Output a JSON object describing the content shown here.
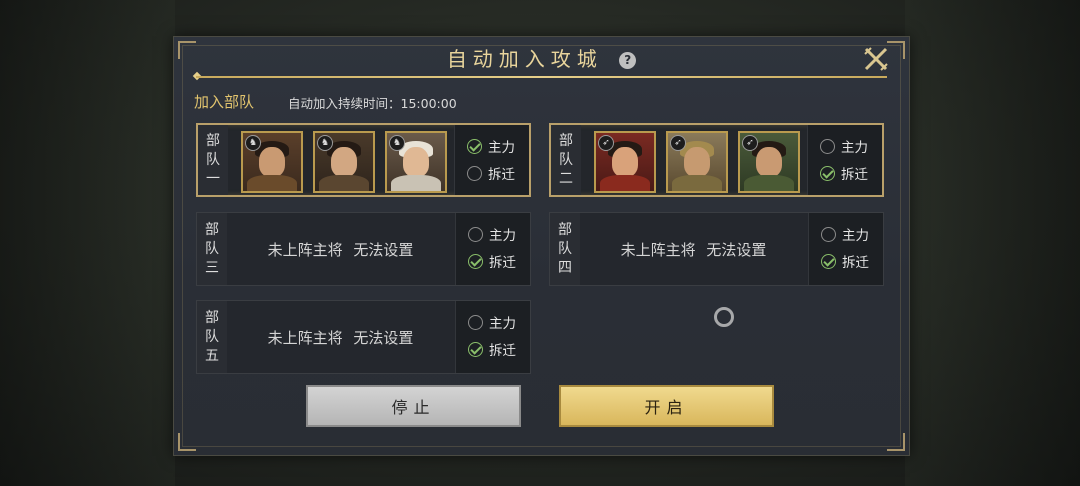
{
  "dialog": {
    "title": "自动加入攻城",
    "help": "?",
    "section_label": "加入部队",
    "duration": "自动加入持续时间：15:00:00"
  },
  "troops": [
    {
      "label": [
        "部",
        "队",
        "一"
      ],
      "portraits": [
        "horse",
        "horse",
        "horse"
      ],
      "options": [
        "主力",
        "拆迁"
      ],
      "selected": "主力"
    },
    {
      "label": [
        "部",
        "队",
        "二"
      ],
      "portraits": [
        "bow",
        "bow",
        "bow"
      ],
      "options": [
        "主力",
        "拆迁"
      ],
      "selected": "拆迁"
    },
    {
      "label": [
        "部",
        "队",
        "三"
      ],
      "empty_text": "未上阵主将 无法设置",
      "options": [
        "主力",
        "拆迁"
      ],
      "selected": "拆迁"
    },
    {
      "label": [
        "部",
        "队",
        "四"
      ],
      "empty_text": "未上阵主将 无法设置",
      "options": [
        "主力",
        "拆迁"
      ],
      "selected": "拆迁"
    },
    {
      "label": [
        "部",
        "队",
        "五"
      ],
      "empty_text": "未上阵主将 无法设置",
      "options": [
        "主力",
        "拆迁"
      ],
      "selected": "拆迁"
    }
  ],
  "buttons": {
    "stop": "停止",
    "start": "开启"
  },
  "colors": {
    "accent_gold": "#e2c46e",
    "check_green": "#8abf6a"
  }
}
